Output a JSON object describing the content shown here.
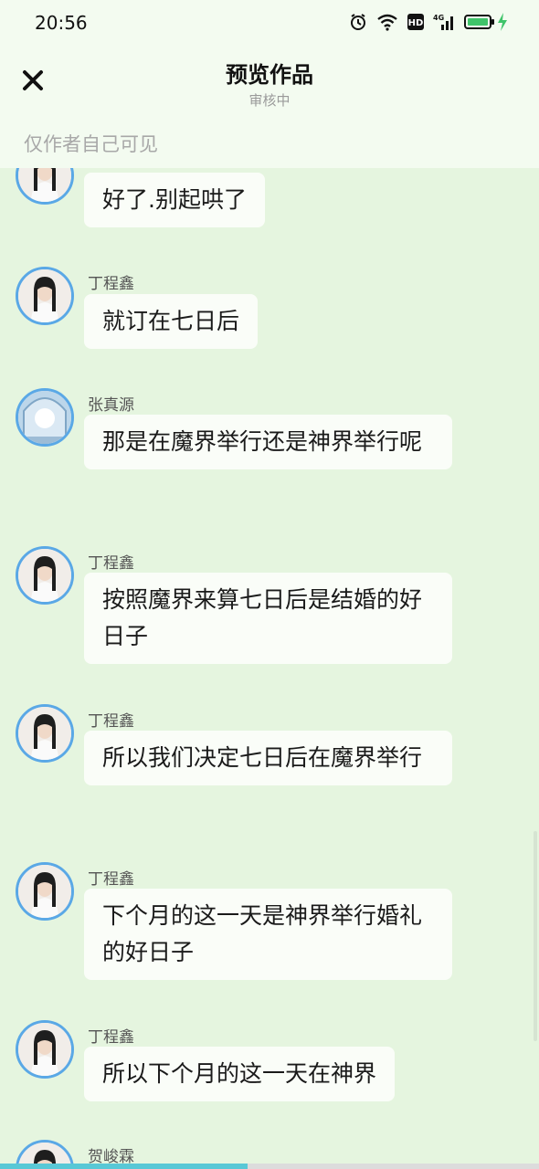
{
  "status_bar": {
    "time": "20:56",
    "network_label": "4G",
    "hd_label": "HD",
    "icons": [
      "alarm-icon",
      "wifi-icon",
      "hd-icon",
      "signal-icon",
      "battery-icon",
      "charging-icon"
    ]
  },
  "header": {
    "title": "预览作品",
    "subtitle": "审核中",
    "close_icon": "close-icon"
  },
  "visibility_note": "仅作者自己可见",
  "messages": [
    {
      "name": "",
      "text": "好了.别起哄了",
      "avatar": "boy-avatar"
    },
    {
      "name": "丁程鑫",
      "text": "就订在七日后",
      "avatar": "boy-avatar"
    },
    {
      "name": "张真源",
      "text": "那是在魔界举行还是神界举行呢",
      "avatar": "moon-avatar"
    },
    {
      "name": "丁程鑫",
      "text": "按照魔界来算七日后是结婚的好日子",
      "avatar": "boy-avatar"
    },
    {
      "name": "丁程鑫",
      "text": "所以我们决定七日后在魔界举行",
      "avatar": "boy-avatar"
    },
    {
      "name": "丁程鑫",
      "text": "下个月的这一天是神界举行婚礼的好日子",
      "avatar": "boy-avatar"
    },
    {
      "name": "丁程鑫",
      "text": "所以下个月的这一天在神界",
      "avatar": "boy-avatar"
    },
    {
      "name": "贺峻霖",
      "text": "",
      "avatar": "boy-avatar"
    }
  ],
  "colors": {
    "background": "#e5f5df",
    "header_background": "#f3fbf0",
    "bubble": "#fafdf8",
    "avatar_border": "#5aa8e6",
    "progress": "#58c8d6"
  },
  "reading_progress": 0.46
}
